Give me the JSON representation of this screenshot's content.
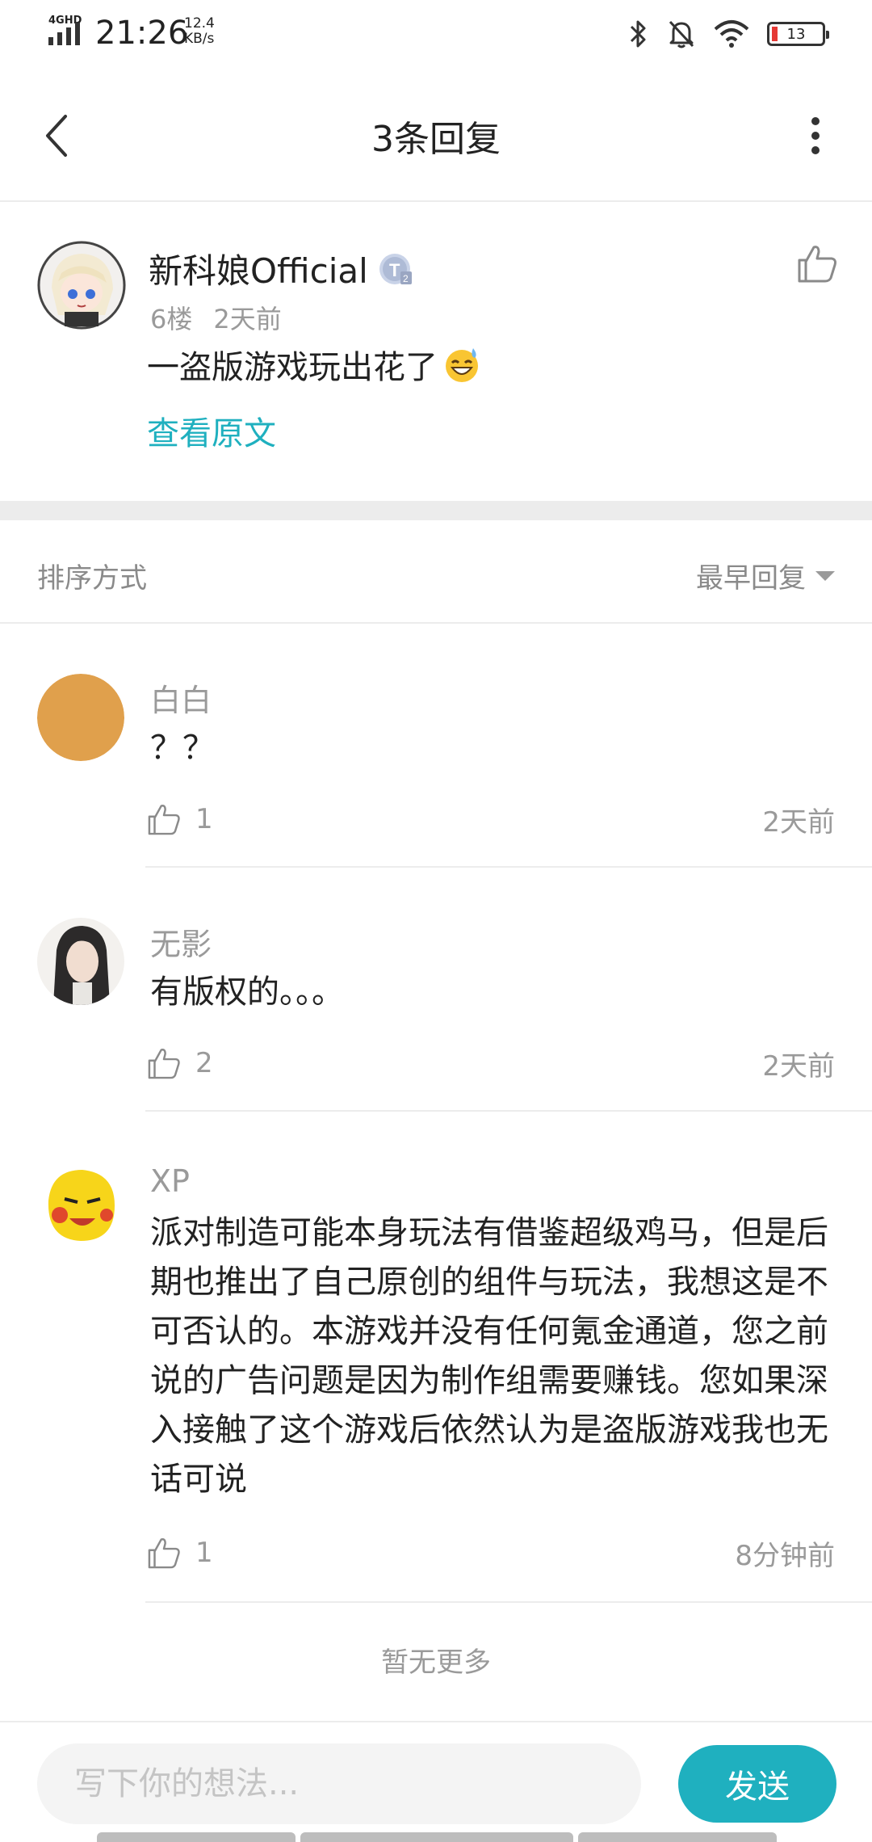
{
  "status_bar": {
    "network": "4GHD",
    "time": "21:26",
    "speed_value": "12.4",
    "speed_unit": "KB/s",
    "battery": "13",
    "icons": [
      "bluetooth-icon",
      "mute-icon",
      "wifi-icon",
      "battery-icon"
    ]
  },
  "header": {
    "title": "3条回复",
    "back_icon": "chevron-left-icon",
    "more_icon": "more-vertical-icon"
  },
  "post": {
    "author": "新科娘Official",
    "badge": "T2",
    "floor": "6楼",
    "time": "2天前",
    "text": "一盗版游戏玩出花了",
    "emoji": "grinning-sweat-emoji",
    "view_original": "查看原文"
  },
  "sort": {
    "label": "排序方式",
    "selected": "最早回复"
  },
  "replies": [
    {
      "name": "白白",
      "text": "？？",
      "likes": "1",
      "time": "2天前"
    },
    {
      "name": "无影",
      "text": "有版权的。。。",
      "likes": "2",
      "time": "2天前"
    },
    {
      "name": "XP",
      "text": "派对制造可能本身玩法有借鉴超级鸡马，但是后期也推出了自己原创的组件与玩法，我想这是不可否认的。本游戏并没有任何氪金通道，您之前说的广告问题是因为制作组需要赚钱。您如果深入接触了这个游戏后依然认为是盗版游戏我也无话可说",
      "likes": "1",
      "time": "8分钟前"
    }
  ],
  "footer": {
    "no_more": "暂无更多",
    "input_placeholder": "写下你的想法...",
    "send": "发送"
  },
  "colors": {
    "accent": "#1fb0bf",
    "muted_text": "#9a9a9a",
    "divider": "#ececec"
  }
}
